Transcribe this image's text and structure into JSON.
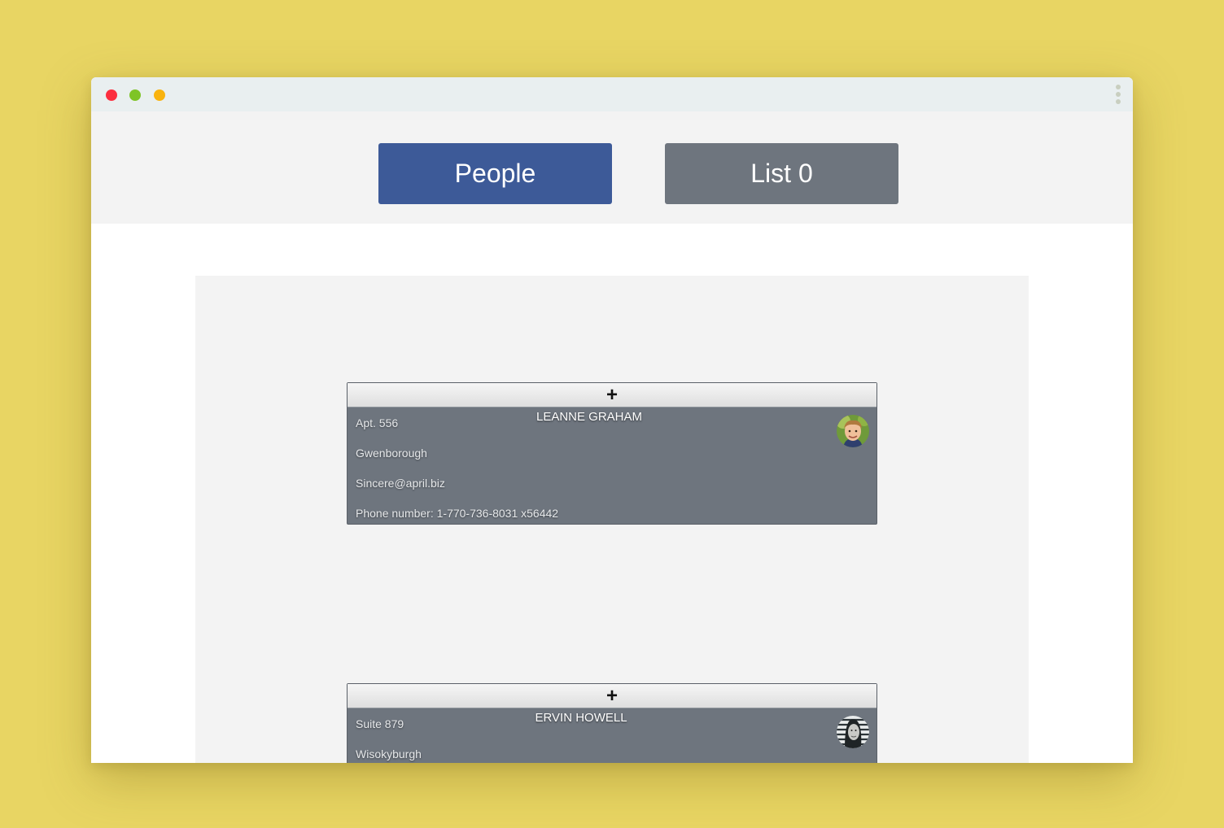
{
  "colors": {
    "background": "#e8d563",
    "window_close": "#fc2f3f",
    "window_minimize": "#7ec426",
    "window_maximize": "#f9b30f",
    "primary_button": "#3d5a98",
    "secondary_button": "#6e757e",
    "card": "#6e757e"
  },
  "window": {
    "controls": [
      "close-icon",
      "minimize-icon",
      "maximize-icon"
    ],
    "menu_icon": "kebab-menu-icon"
  },
  "nav": {
    "people_label": "People",
    "list_label": "List 0"
  },
  "people": [
    {
      "add_label": "+",
      "name": "LEANNE GRAHAM",
      "suite": "Apt. 556",
      "city": "Gwenborough",
      "email": "Sincere@april.biz",
      "phone": "Phone number: 1-770-736-8031 x56442",
      "avatar_icon": "avatar-boy-icon"
    },
    {
      "add_label": "+",
      "name": "ERVIN HOWELL",
      "suite": "Suite 879",
      "city": "Wisokyburgh",
      "avatar_icon": "avatar-woman-icon"
    }
  ]
}
